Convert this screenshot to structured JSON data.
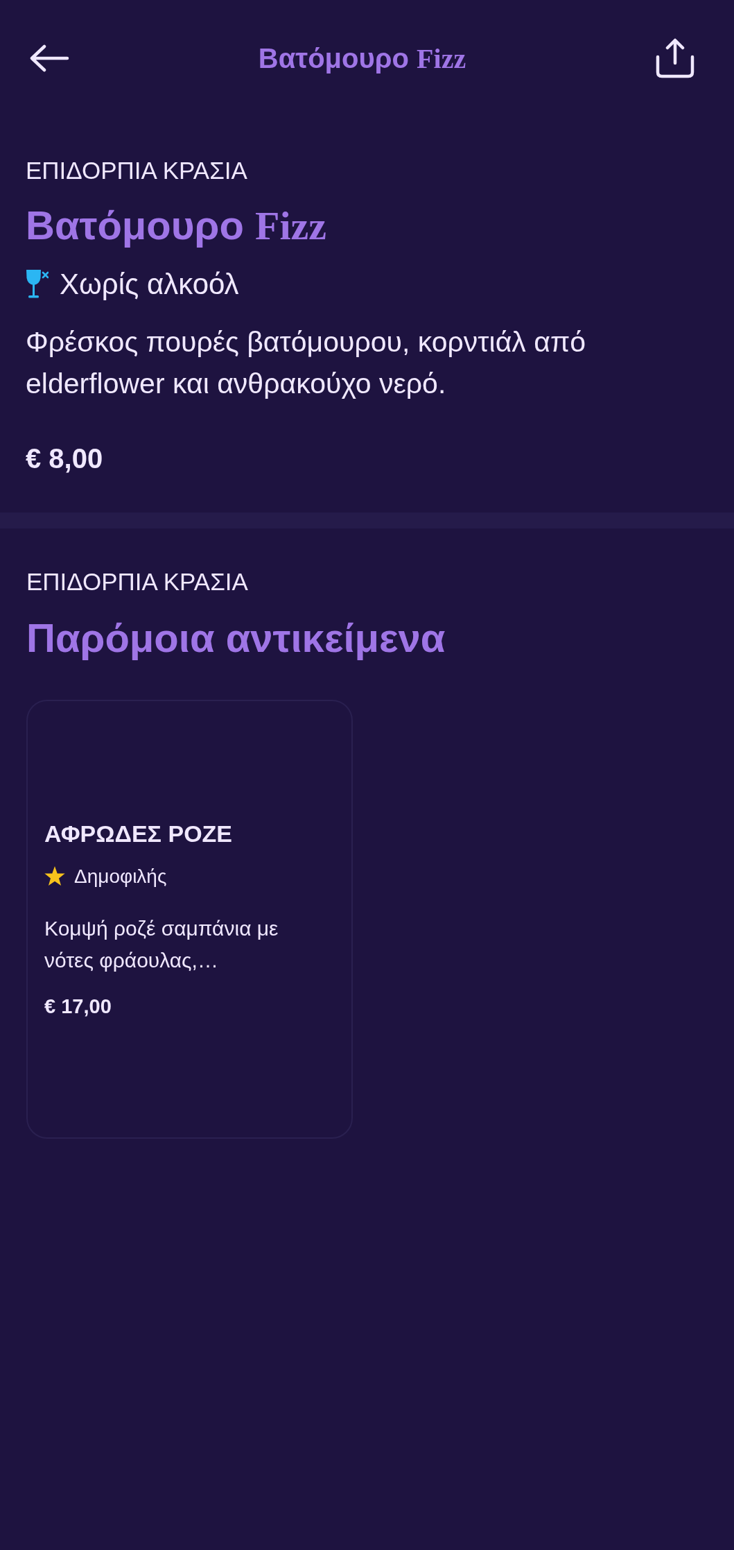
{
  "header": {
    "title_parts": [
      "Βατόμουρο",
      "Fizz"
    ]
  },
  "item": {
    "category": "ΕΠΙΔΟΡΠΙΑ ΚΡΑΣΙΑ",
    "title_parts": [
      "Βατόμουρο",
      "Fizz"
    ],
    "tag": {
      "kind": "no-alcohol",
      "label": "Χωρίς αλκοόλ"
    },
    "description": "Φρέσκος πουρές βατόμουρου, κορντιάλ από elderflower και ανθρακούχο νερό.",
    "price": "€ 8,00"
  },
  "similar": {
    "category": "ΕΠΙΔΟΡΠΙΑ ΚΡΑΣΙΑ",
    "title": "Παρόμοια αντικείμενα",
    "items": [
      {
        "name": "ΑΦΡΩΔΕΣ ΡΟΖΕ",
        "badge": {
          "kind": "popular",
          "label": "Δημοφιλής"
        },
        "description": "Κομψή ροζέ σαμπάνια με νότες φράουλας,…",
        "price": "€ 17,00"
      }
    ]
  }
}
